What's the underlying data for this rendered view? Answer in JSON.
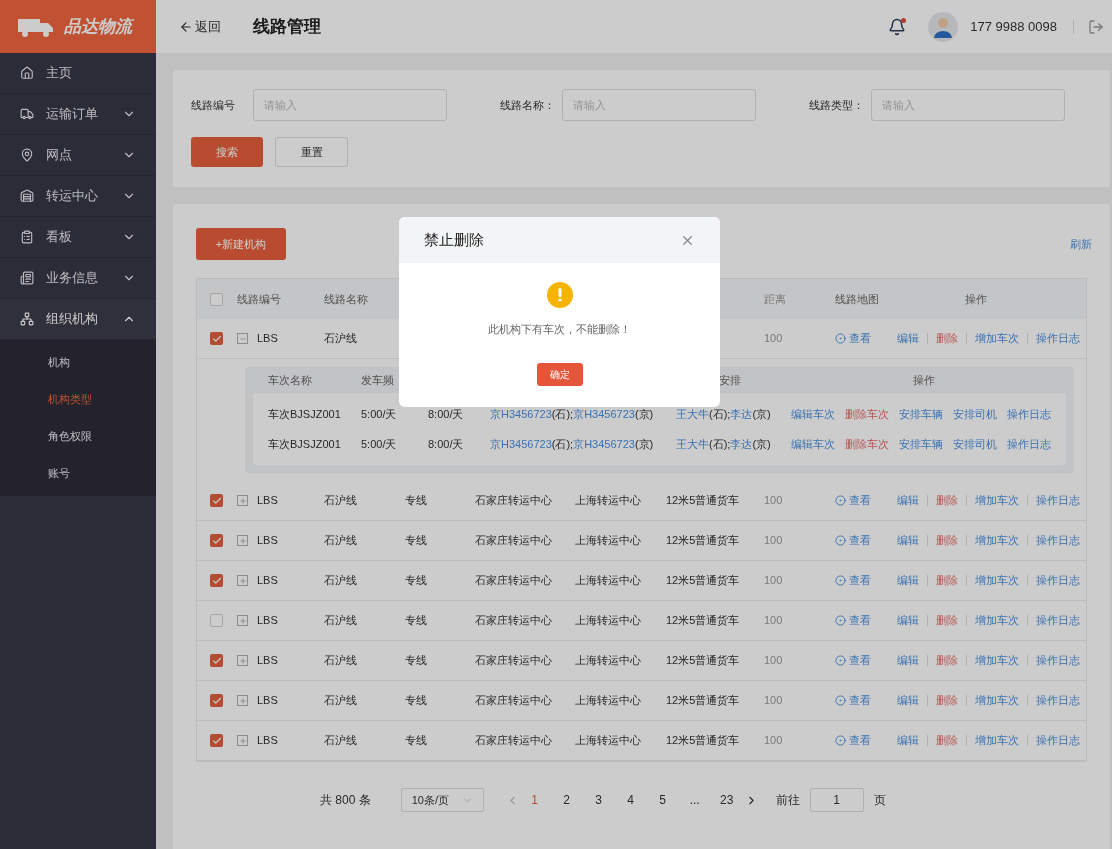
{
  "sidebar": {
    "logo": "品达物流",
    "items": [
      {
        "label": "主页",
        "kind": "link"
      },
      {
        "label": "运输订单",
        "kind": "group",
        "expanded": false
      },
      {
        "label": "网点",
        "kind": "group",
        "expanded": false
      },
      {
        "label": "转运中心",
        "kind": "group",
        "expanded": false
      },
      {
        "label": "看板",
        "kind": "group",
        "expanded": false
      },
      {
        "label": "业务信息",
        "kind": "group",
        "expanded": false
      },
      {
        "label": "组织机构",
        "kind": "group",
        "expanded": true,
        "children": [
          {
            "label": "机构",
            "selected": false
          },
          {
            "label": "机构类型",
            "selected": true
          },
          {
            "label": "角色权限",
            "selected": false
          },
          {
            "label": "账号",
            "selected": false
          }
        ]
      }
    ]
  },
  "header": {
    "back": "返回",
    "title": "线路管理",
    "phone": "177 9988 0098",
    "has_notice": true
  },
  "search": {
    "fields": [
      {
        "label": "线路编号",
        "placeholder": "请输入"
      },
      {
        "label": "线路名称：",
        "placeholder": "请输入"
      },
      {
        "label": "线路类型：",
        "placeholder": "请输入"
      }
    ],
    "search_button": "搜索",
    "reset_button": "重置"
  },
  "table": {
    "new_button": "+新建机构",
    "refresh": "刷新",
    "all_checked": false,
    "columns": {
      "code": "线路编号",
      "name": "线路名称",
      "distance": "距离",
      "map": "线路地图",
      "ops": "操作"
    },
    "rows": [
      {
        "checked": true,
        "expanded": true,
        "code": "LBS",
        "name": "石沪线",
        "distance": "100",
        "map": "查看",
        "actions": [
          {
            "label": "编辑",
            "kind": "link"
          },
          {
            "label": "删除",
            "kind": "danger"
          },
          {
            "label": "增加车次",
            "kind": "link"
          },
          {
            "label": "操作日志",
            "kind": "link"
          }
        ],
        "trips": {
          "columns": {
            "name": "车次名称",
            "depart": "发车频",
            "driver": "安排",
            "ops": "操作"
          },
          "rows": [
            {
              "name": "车次BJSJZ001",
              "depart": "5:00/天",
              "arrive": "8:00/天",
              "vehicles": [
                {
                  "plate": "京H3456723",
                  "site": "(石);"
                },
                {
                  "plate": "京H3456723",
                  "site": "(京)"
                }
              ],
              "drivers": [
                {
                  "name": "王大牛",
                  "site": "(石);"
                },
                {
                  "name": "李达",
                  "site": "(京)"
                }
              ],
              "actions": [
                {
                  "label": "编辑车次",
                  "kind": "link"
                },
                {
                  "label": "删除车次",
                  "kind": "danger"
                },
                {
                  "label": "安排车辆",
                  "kind": "link"
                },
                {
                  "label": "安排司机",
                  "kind": "link"
                },
                {
                  "label": "操作日志",
                  "kind": "link"
                }
              ]
            },
            {
              "name": "车次BJSJZ001",
              "depart": "5:00/天",
              "arrive": "8:00/天",
              "vehicles": [
                {
                  "plate": "京H3456723",
                  "site": "(石);"
                },
                {
                  "plate": "京H3456723",
                  "site": "(京)"
                }
              ],
              "drivers": [
                {
                  "name": "王大牛",
                  "site": "(石);"
                },
                {
                  "name": "李达",
                  "site": "(京)"
                }
              ],
              "actions": [
                {
                  "label": "编辑车次",
                  "kind": "link"
                },
                {
                  "label": "删除车次",
                  "kind": "danger"
                },
                {
                  "label": "安排车辆",
                  "kind": "link"
                },
                {
                  "label": "安排司机",
                  "kind": "link"
                },
                {
                  "label": "操作日志",
                  "kind": "link"
                }
              ]
            }
          ]
        }
      },
      {
        "checked": true,
        "expanded": false,
        "code": "LBS",
        "name": "石沪线",
        "type": "专线",
        "from": "石家庄转运中心",
        "to": "上海转运中心",
        "vehicle": "12米5普通货车",
        "distance": "100",
        "map": "查看",
        "actions": [
          {
            "label": "编辑",
            "kind": "link"
          },
          {
            "label": "删除",
            "kind": "danger"
          },
          {
            "label": "增加车次",
            "kind": "link"
          },
          {
            "label": "操作日志",
            "kind": "link"
          }
        ]
      },
      {
        "checked": true,
        "expanded": false,
        "code": "LBS",
        "name": "石沪线",
        "type": "专线",
        "from": "石家庄转运中心",
        "to": "上海转运中心",
        "vehicle": "12米5普通货车",
        "distance": "100",
        "map": "查看",
        "actions": [
          {
            "label": "编辑",
            "kind": "link"
          },
          {
            "label": "删除",
            "kind": "danger"
          },
          {
            "label": "增加车次",
            "kind": "link"
          },
          {
            "label": "操作日志",
            "kind": "link"
          }
        ]
      },
      {
        "checked": true,
        "expanded": false,
        "code": "LBS",
        "name": "石沪线",
        "type": "专线",
        "from": "石家庄转运中心",
        "to": "上海转运中心",
        "vehicle": "12米5普通货车",
        "distance": "100",
        "map": "查看",
        "actions": [
          {
            "label": "编辑",
            "kind": "link"
          },
          {
            "label": "删除",
            "kind": "danger"
          },
          {
            "label": "增加车次",
            "kind": "link"
          },
          {
            "label": "操作日志",
            "kind": "link"
          }
        ]
      },
      {
        "checked": false,
        "expanded": false,
        "code": "LBS",
        "name": "石沪线",
        "type": "专线",
        "from": "石家庄转运中心",
        "to": "上海转运中心",
        "vehicle": "12米5普通货车",
        "distance": "100",
        "map": "查看",
        "actions": [
          {
            "label": "编辑",
            "kind": "link"
          },
          {
            "label": "删除",
            "kind": "danger"
          },
          {
            "label": "增加车次",
            "kind": "link"
          },
          {
            "label": "操作日志",
            "kind": "link"
          }
        ]
      },
      {
        "checked": true,
        "expanded": false,
        "code": "LBS",
        "name": "石沪线",
        "type": "专线",
        "from": "石家庄转运中心",
        "to": "上海转运中心",
        "vehicle": "12米5普通货车",
        "distance": "100",
        "map": "查看",
        "actions": [
          {
            "label": "编辑",
            "kind": "link"
          },
          {
            "label": "删除",
            "kind": "danger"
          },
          {
            "label": "增加车次",
            "kind": "link"
          },
          {
            "label": "操作日志",
            "kind": "link"
          }
        ]
      },
      {
        "checked": true,
        "expanded": false,
        "code": "LBS",
        "name": "石沪线",
        "type": "专线",
        "from": "石家庄转运中心",
        "to": "上海转运中心",
        "vehicle": "12米5普通货车",
        "distance": "100",
        "map": "查看",
        "actions": [
          {
            "label": "编辑",
            "kind": "link"
          },
          {
            "label": "删除",
            "kind": "danger"
          },
          {
            "label": "增加车次",
            "kind": "link"
          },
          {
            "label": "操作日志",
            "kind": "link"
          }
        ]
      },
      {
        "checked": true,
        "expanded": false,
        "code": "LBS",
        "name": "石沪线",
        "type": "专线",
        "from": "石家庄转运中心",
        "to": "上海转运中心",
        "vehicle": "12米5普通货车",
        "distance": "100",
        "map": "查看",
        "actions": [
          {
            "label": "编辑",
            "kind": "link"
          },
          {
            "label": "删除",
            "kind": "danger"
          },
          {
            "label": "增加车次",
            "kind": "link"
          },
          {
            "label": "操作日志",
            "kind": "link"
          }
        ]
      }
    ]
  },
  "pagination": {
    "total": "共 800 条",
    "page_size": "10条/页",
    "pages": [
      {
        "label": "1",
        "selected": true
      },
      {
        "label": "2",
        "selected": false
      },
      {
        "label": "3",
        "selected": false
      },
      {
        "label": "4",
        "selected": false
      },
      {
        "label": "5",
        "selected": false
      },
      {
        "label": "...",
        "selected": false
      },
      {
        "label": "23",
        "selected": false
      }
    ],
    "goto": "前往",
    "goto_value": "1",
    "page_unit": "页"
  },
  "modal": {
    "title": "禁止删除",
    "message": "此机构下有车次，不能删除！",
    "confirm": "确定"
  }
}
